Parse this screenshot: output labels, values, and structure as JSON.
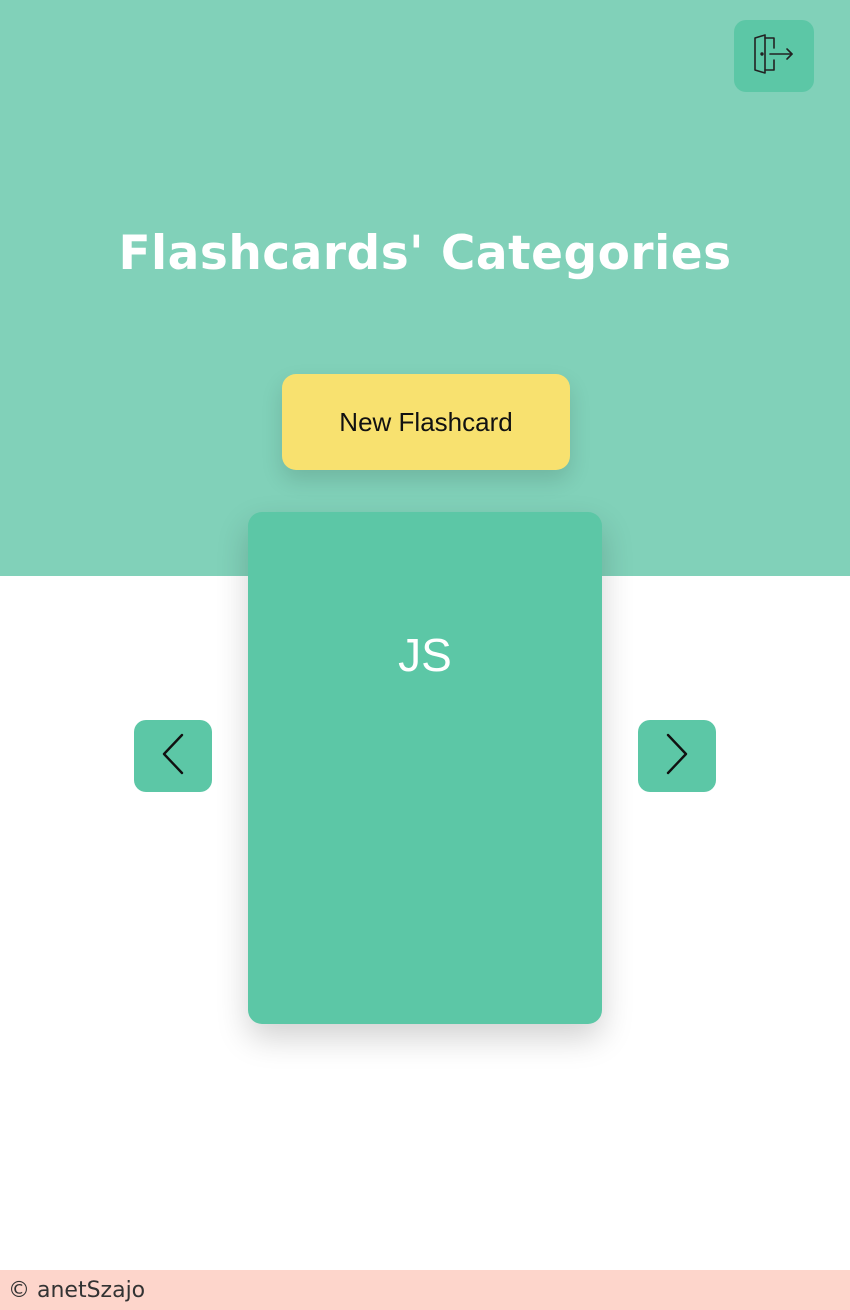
{
  "header": {
    "logout_icon": "logout-door-icon",
    "title": "Flashcards' Categories",
    "new_button_label": "New Flashcard"
  },
  "carousel": {
    "prev_icon": "chevron-left-icon",
    "next_icon": "chevron-right-icon",
    "current_card_title": "JS"
  },
  "footer": {
    "copyright": "© anetSzajo"
  },
  "colors": {
    "hero_background": "#81d1b9",
    "accent_green": "#5cc7a6",
    "button_yellow": "#f8e16f",
    "footer_background": "#fdd5cb"
  }
}
